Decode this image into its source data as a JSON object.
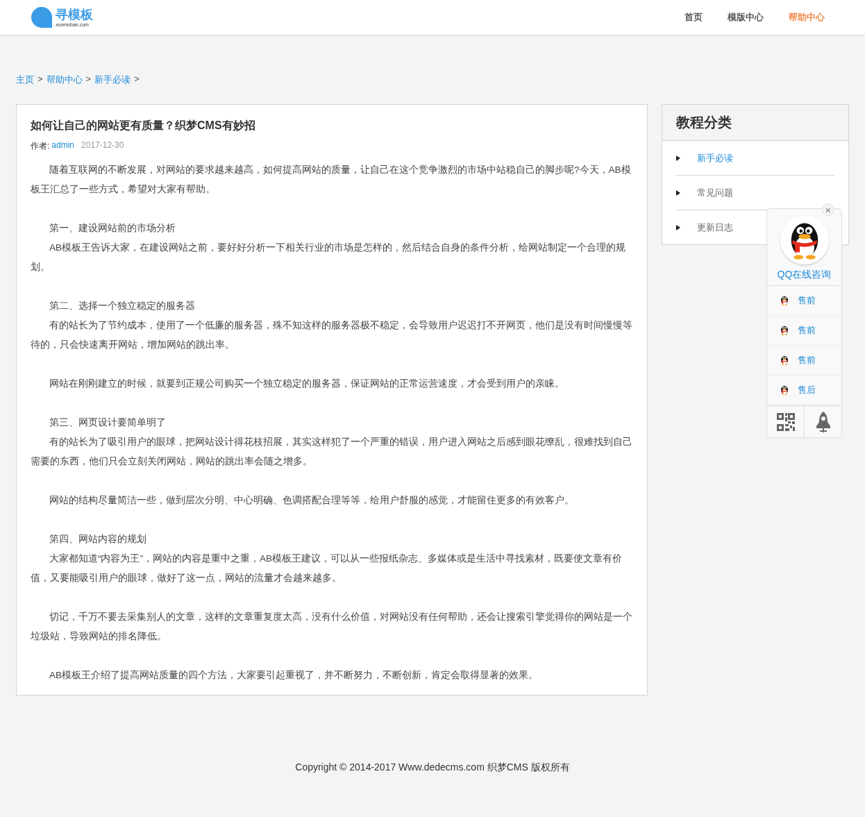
{
  "header": {
    "logo": {
      "name": "寻模板",
      "domain": "xunmoban.com"
    },
    "nav": [
      {
        "label": "首页",
        "selected": false
      },
      {
        "label": "模版中心",
        "selected": false
      },
      {
        "label": "帮助中心",
        "selected": true
      }
    ]
  },
  "breadcrumb": [
    {
      "label": "主页",
      "separator": ">"
    },
    {
      "label": "帮助中心",
      "separator": ">"
    },
    {
      "label": "新手必读",
      "separator": ">"
    }
  ],
  "article": {
    "title": "如何让自己的网站更有质量？织梦CMS有妙招",
    "author_label": "作者:",
    "author": "admin",
    "date": "2017-12-30",
    "sections": [
      [
        "随着互联网的不断发展，对网站的要求越来越高，如何提高网站的质量，让自己在这个竞争激烈的市场中站稳自己的脚步呢?今天，AB模板王汇总了一些方式，希望对大家有帮助。"
      ],
      [
        "第一、建设网站前的市场分析",
        "AB模板王告诉大家，在建设网站之前，要好好分析一下相关行业的市场是怎样的，然后结合自身的条件分析，给网站制定一个合理的规划。"
      ],
      [
        "第二、选择一个独立稳定的服务器",
        "有的站长为了节约成本，使用了一个低廉的服务器，殊不知这样的服务器极不稳定，会导致用户迟迟打不开网页，他们是没有时间慢慢等待的，只会快速离开网站，增加网站的跳出率。"
      ],
      [
        "网站在刚刚建立的时候，就要到正规公司购买一个独立稳定的服务器，保证网站的正常运营速度，才会受到用户的亲睐。"
      ],
      [
        "第三、网页设计要简单明了",
        "有的站长为了吸引用户的眼球，把网站设计得花枝招展，其实这样犯了一个严重的错误，用户进入网站之后感到眼花缭乱，很难找到自己需要的东西，他们只会立刻关闭网站，网站的跳出率会随之增多。"
      ],
      [
        "网站的结构尽量简洁一些，做到层次分明、中心明确、色调搭配合理等等，给用户舒服的感觉，才能留住更多的有效客户。"
      ],
      [
        "第四、网站内容的规划",
        "大家都知道“内容为王”，网站的内容是重中之重，AB模板王建议，可以从一些报纸杂志、多媒体或是生活中寻找素材，既要使文章有价值，又要能吸引用户的眼球，做好了这一点，网站的流量才会越来越多。"
      ],
      [
        "切记，千万不要去采集别人的文章，这样的文章重复度太高，没有什么价值，对网站没有任何帮助，还会让搜索引擎觉得你的网站是一个垃圾站，导致网站的排名降低。"
      ],
      [
        "AB模板王介绍了提高网站质量的四个方法，大家要引起重视了，并不断努力，不断创新，肯定会取得显著的效果。"
      ]
    ]
  },
  "sidebar": {
    "title": "教程分类",
    "items": [
      {
        "label": "新手必读",
        "selected": true
      },
      {
        "label": "常见问题",
        "selected": false
      },
      {
        "label": "更新日志",
        "selected": false
      }
    ]
  },
  "qq_widget": {
    "title": "QQ在线咨询",
    "close": "×",
    "contacts": [
      "售前",
      "售前",
      "售前",
      "售后"
    ]
  },
  "footer": "Copyright © 2014-2017 Www.dedecms.com 织梦CMS 版权所有"
}
